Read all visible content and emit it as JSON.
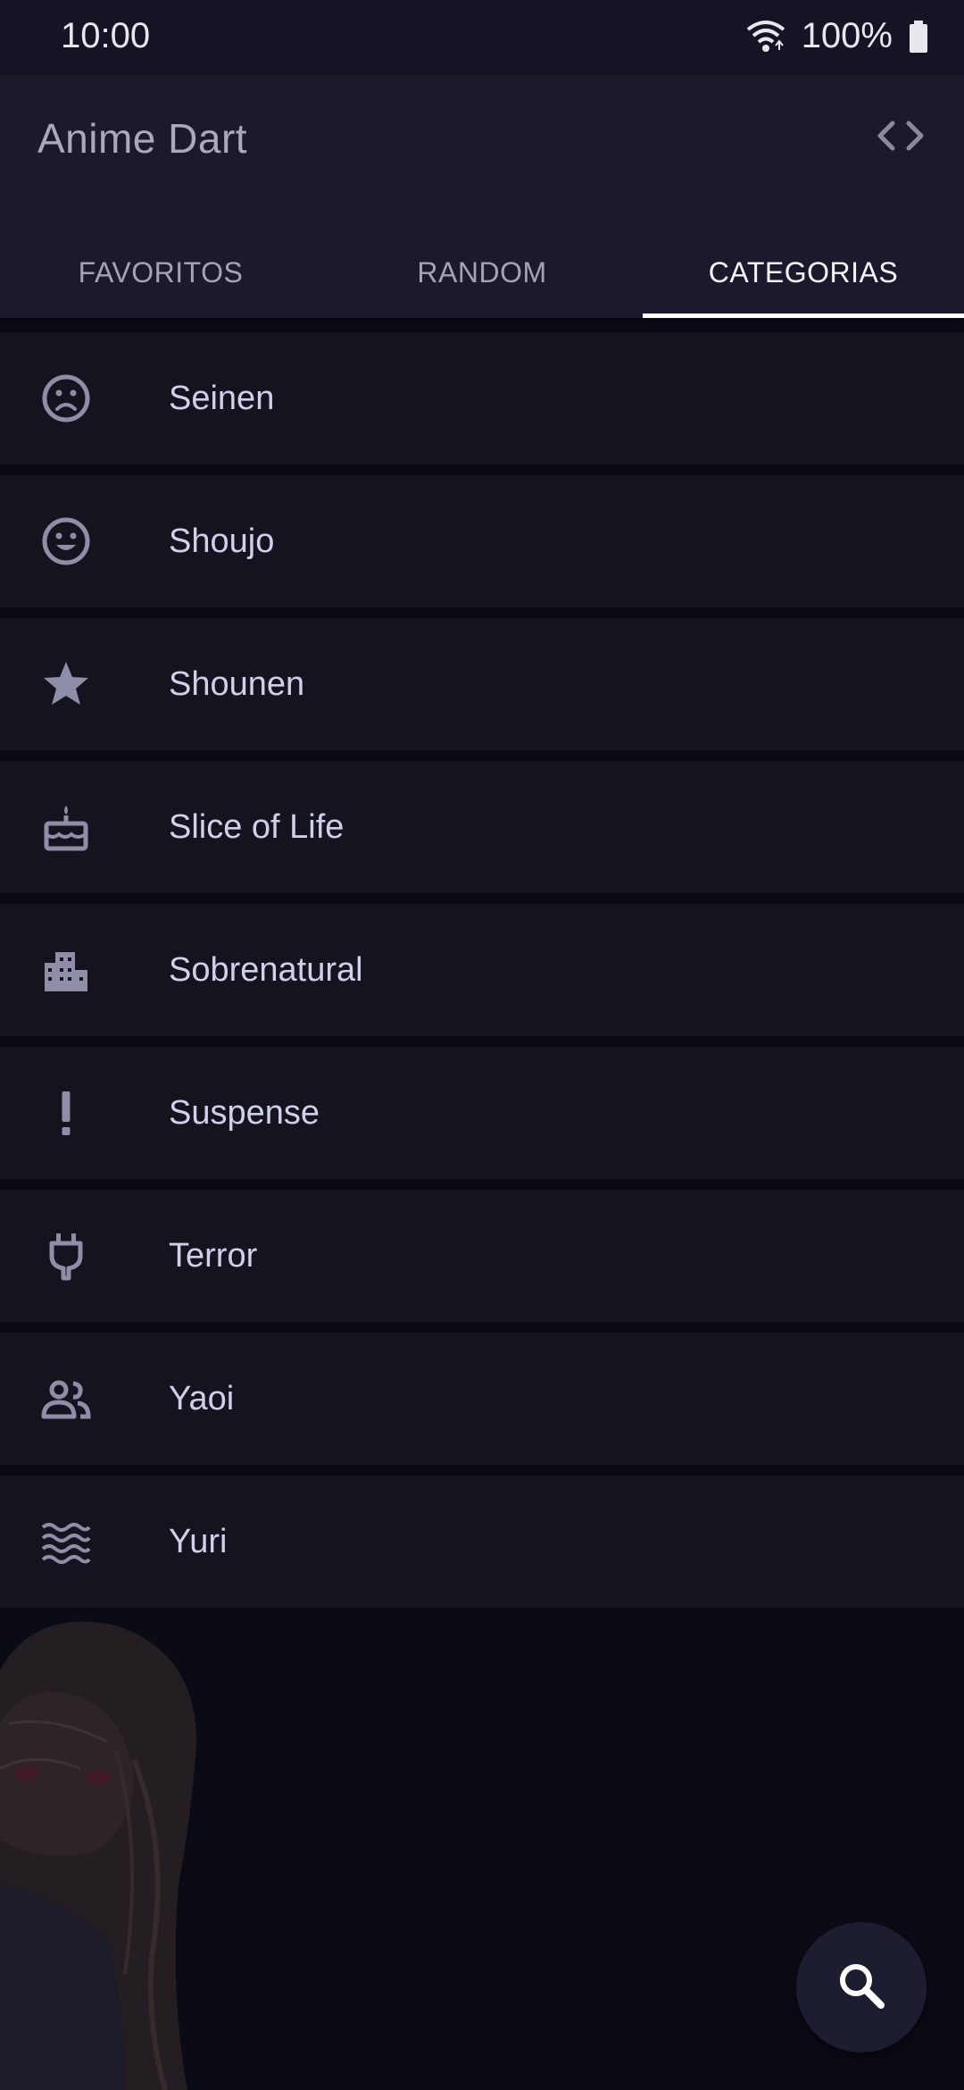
{
  "status_bar": {
    "time": "10:00",
    "battery": "100%"
  },
  "app_bar": {
    "title": "Anime Dart",
    "action_icon": "code-icon"
  },
  "tabs": [
    {
      "label": "FAVORITOS",
      "active": false
    },
    {
      "label": "RANDOM",
      "active": false
    },
    {
      "label": "CATEGORIAS",
      "active": true
    }
  ],
  "categories": [
    {
      "label": "Seinen",
      "icon": "sad-face-icon"
    },
    {
      "label": "Shoujo",
      "icon": "happy-face-icon"
    },
    {
      "label": "Shounen",
      "icon": "star-icon"
    },
    {
      "label": "Slice of Life",
      "icon": "cake-icon"
    },
    {
      "label": "Sobrenatural",
      "icon": "building-icon"
    },
    {
      "label": "Suspense",
      "icon": "exclamation-icon"
    },
    {
      "label": "Terror",
      "icon": "plug-icon"
    },
    {
      "label": "Yaoi",
      "icon": "people-icon"
    },
    {
      "label": "Yuri",
      "icon": "waves-icon"
    }
  ],
  "fab": {
    "icon": "search-icon"
  },
  "colors": {
    "background": "#0b0b15",
    "app_bar": "#1a1a2c",
    "list_item": "#14141f",
    "icon": "#8e8ea8",
    "label": "#cfd0ea"
  }
}
